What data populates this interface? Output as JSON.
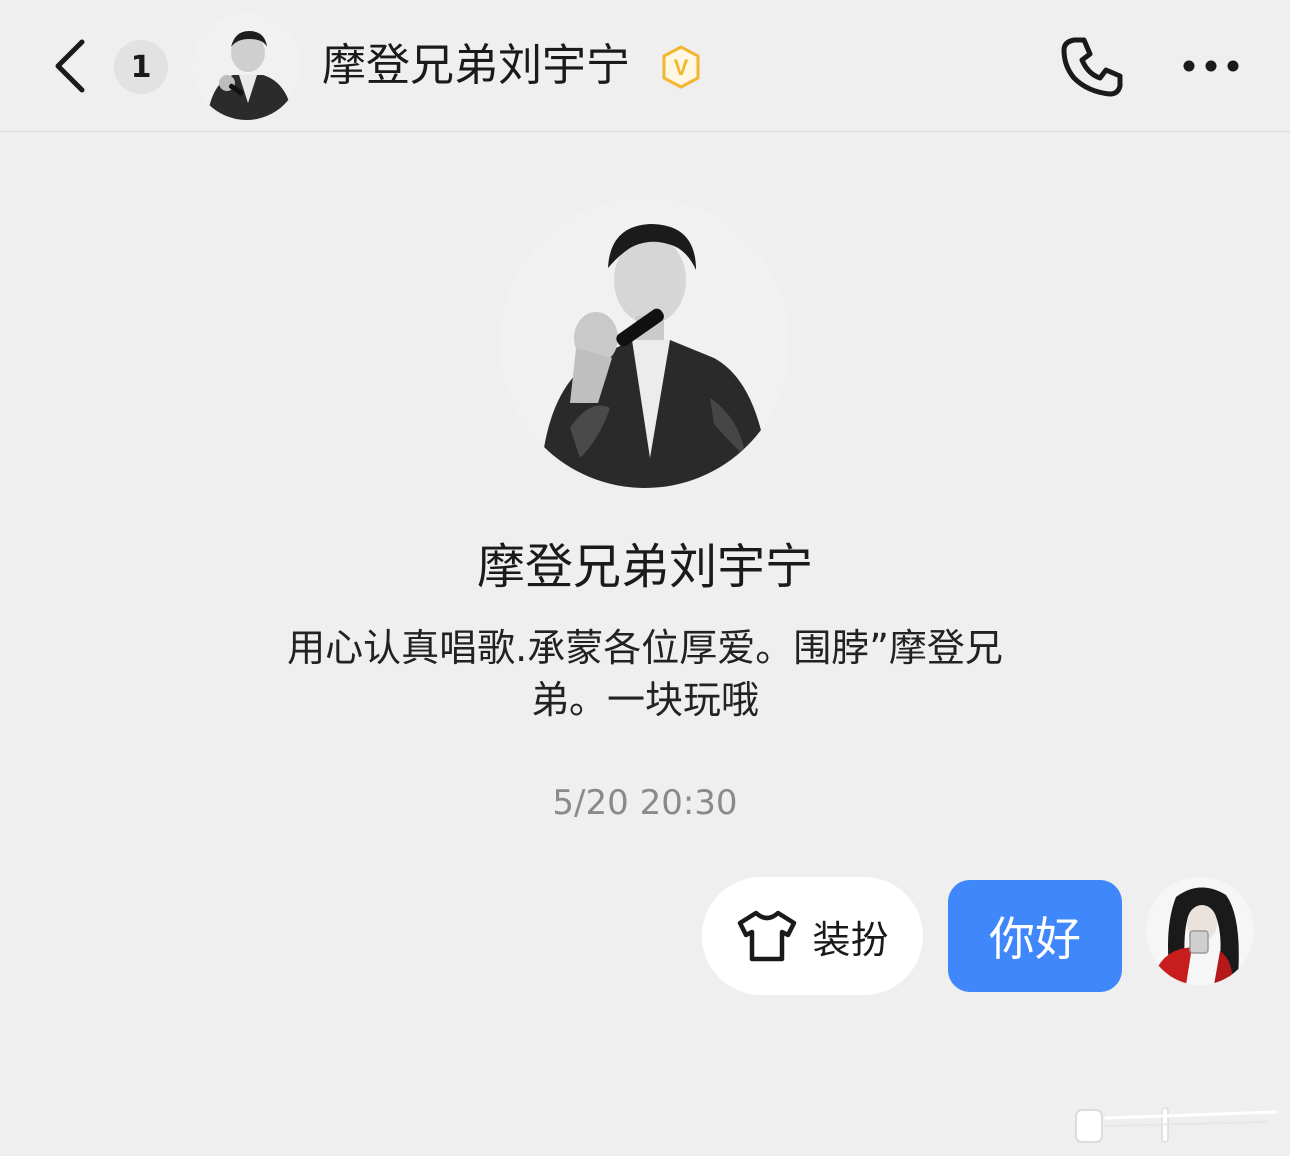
{
  "header": {
    "back_icon": "chevron-left-icon",
    "unread_count": "1",
    "title": "摩登兄弟刘宇宁",
    "verified_icon": "verified-v-icon",
    "verified_letter": "V",
    "call_icon": "phone-icon",
    "more_icon": "more-horizontal-icon"
  },
  "profile": {
    "name": "摩登兄弟刘宇宁",
    "bio": "用心认真唱歌.承蒙各位厚爱。围脖”摩登兄弟。一块玩哦"
  },
  "chat": {
    "timestamp": "5/20 20:30",
    "dressup_label": "装扮",
    "dressup_icon": "tshirt-icon",
    "messages": [
      {
        "from": "me",
        "text": "你好"
      }
    ]
  },
  "colors": {
    "background": "#efefef",
    "bubble_blue": "#3f87fa",
    "verified_gold": "#f2b630",
    "divider": "#d9d9d9"
  }
}
